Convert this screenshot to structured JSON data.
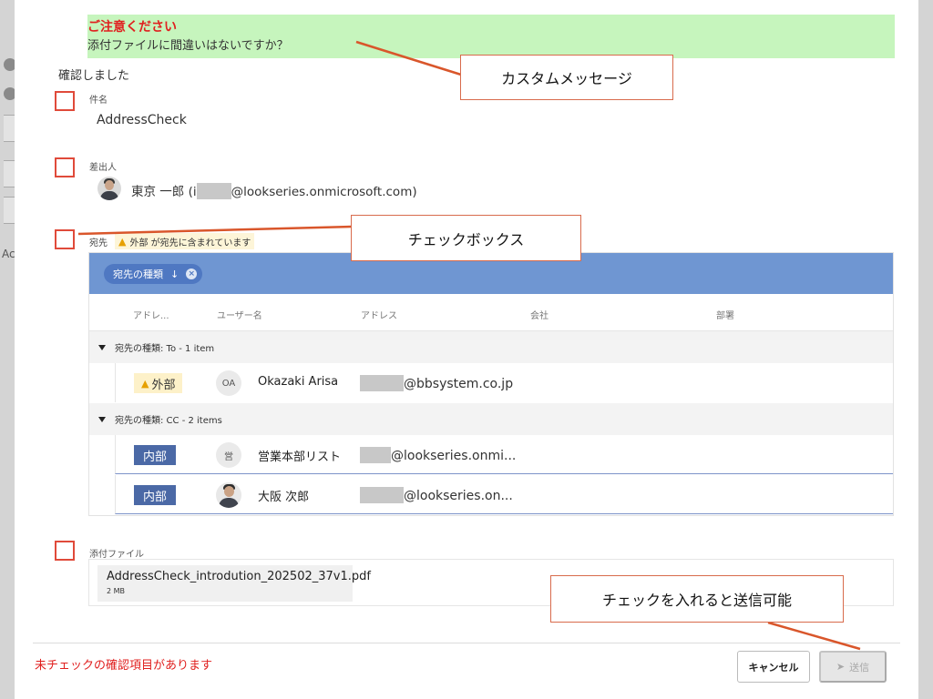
{
  "background": {
    "snippet": "Ac"
  },
  "warning": {
    "title": "ご注意ください",
    "message": "添付ファイルに間違いはないですか？"
  },
  "confirmed_label": "確認しました",
  "subject": {
    "label": "件名",
    "value": "AddressCheck"
  },
  "sender": {
    "label": "差出人",
    "name_prefix": "東京 一郎 (i",
    "email_suffix": "@lookseries.onmicrosoft.com)"
  },
  "recipients": {
    "label": "宛先",
    "external_warning": "外部 が宛先に含まれています",
    "group_chip": "宛先の種類",
    "group_chip_arrow": "↓",
    "group_chip_close": "×",
    "columns": [
      "アドレ...",
      "ユーザー名",
      "アドレス",
      "会社",
      "部署"
    ],
    "groups": [
      {
        "label": "宛先の種類: To - 1 item",
        "rows": [
          {
            "badge": "外部",
            "badge_type": "external",
            "initials": "OA",
            "name": "Okazaki Arisa",
            "address": "@bbsystem.co.jp"
          }
        ]
      },
      {
        "label": "宛先の種類: CC - 2 items",
        "rows": [
          {
            "badge": "内部",
            "badge_type": "internal",
            "initials": "営",
            "name": "営業本部リスト",
            "address": "@lookseries.onmi..."
          },
          {
            "badge": "内部",
            "badge_type": "internal",
            "initials": "",
            "name": "大阪 次郎",
            "address": "@lookseries.on..."
          }
        ]
      }
    ]
  },
  "attachments": {
    "label": "添付ファイル",
    "file_name": "AddressCheck_introdution_202502_37v1.pdf",
    "file_size": "2 MB"
  },
  "footer": {
    "unchecked_message": "未チェックの確認項目があります",
    "cancel_label": "キャンセル",
    "send_label": "送信"
  },
  "callouts": {
    "custom_message": "カスタムメッセージ",
    "checkbox": "チェックボックス",
    "send_enabled": "チェックを入れると送信可能"
  },
  "colors": {
    "banner_bg": "#c6f5bd",
    "warning_red": "#e0201f",
    "checkbox_border": "#e04a3a",
    "group_bar": "#6f96d2",
    "internal_badge": "#4b69a6",
    "external_badge": "#fdf1c9",
    "callout_line": "#d9562b"
  }
}
